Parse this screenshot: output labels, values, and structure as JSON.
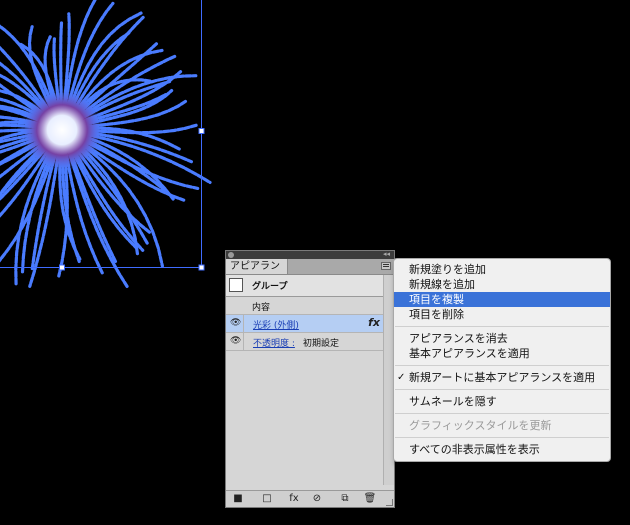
{
  "appearance_panel": {
    "tab_title": "アピアランス",
    "collapse_glyph": "◂◂",
    "group_label": "グループ",
    "contents_label": "内容",
    "effect_label": "光彩 (外側)",
    "opacity_label": "不透明度 :",
    "opacity_value": "初期設定",
    "fx_glyph": "fx",
    "footer_buttons": [
      "new-art-icon",
      "square-icon",
      "fx-icon",
      "clear-icon",
      "duplicate-icon",
      "trash-icon"
    ]
  },
  "flyout_menu": {
    "items": [
      {
        "label": "新規塗りを追加",
        "state": "normal"
      },
      {
        "label": "新規線を追加",
        "state": "normal"
      },
      {
        "label": "項目を複製",
        "state": "highlighted"
      },
      {
        "label": "項目を削除",
        "state": "normal"
      },
      {
        "label": "アピアランスを消去",
        "state": "normal"
      },
      {
        "label": "基本アピアランスを適用",
        "state": "normal"
      },
      {
        "label": "新規アートに基本アピアランスを適用",
        "state": "checked"
      },
      {
        "label": "サムネールを隠す",
        "state": "normal"
      },
      {
        "label": "グラフィックスタイルを更新",
        "state": "disabled"
      },
      {
        "label": "すべての非表示属性を表示",
        "state": "normal"
      }
    ],
    "check_glyph": "✓"
  },
  "colors": {
    "firework": "#4a7cff",
    "selection": "#3f6cff",
    "highlight": "#3a72d8"
  }
}
